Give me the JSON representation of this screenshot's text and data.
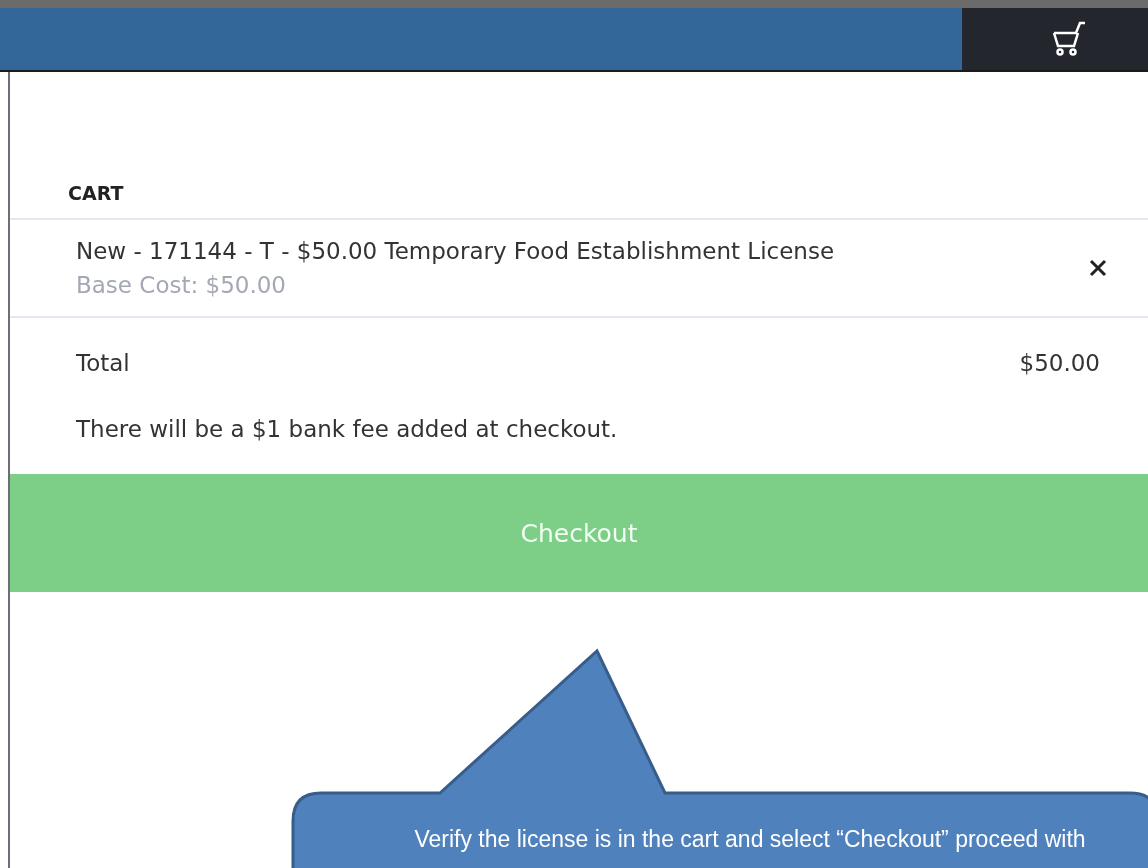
{
  "cart": {
    "title": "CART",
    "items": [
      {
        "name": "New - 171144 - T - $50.00 Temporary Food Establishment License",
        "base_cost": "Base Cost: $50.00"
      }
    ],
    "total_label": "Total",
    "total_value": "$50.00",
    "fee_note": "There will be a $1 bank fee added at checkout.",
    "checkout_button": "Checkout"
  },
  "callout": {
    "text": "Verify the license is in the cart and select “Checkout” proceed with"
  }
}
